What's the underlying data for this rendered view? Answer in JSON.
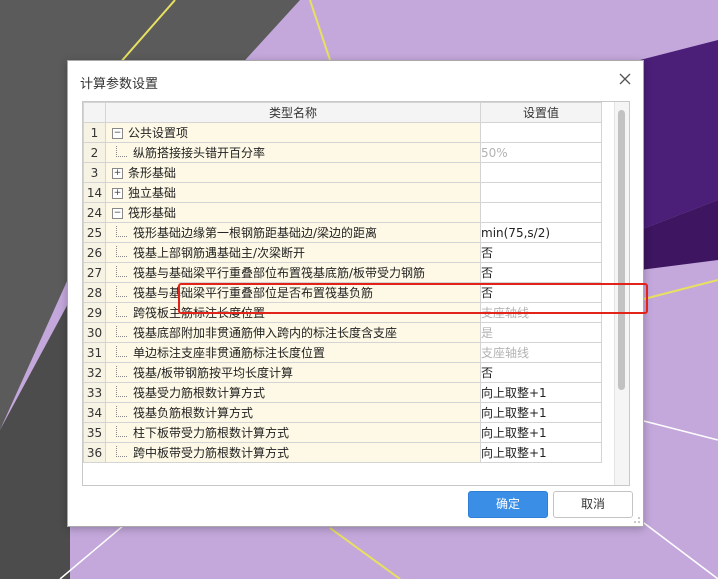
{
  "dialog": {
    "title": "计算参数设置",
    "ok_label": "确定",
    "cancel_label": "取消"
  },
  "table": {
    "headers": [
      "类型名称",
      "设置值"
    ],
    "rows": [
      {
        "num": "1",
        "name": "公共设置项",
        "value": "",
        "kind": "group",
        "expander": "−"
      },
      {
        "num": "2",
        "name": "纵筋搭接接头错开百分率",
        "value": "50%",
        "kind": "child",
        "dim": true
      },
      {
        "num": "3",
        "name": "条形基础",
        "value": "",
        "kind": "group",
        "expander": "+"
      },
      {
        "num": "14",
        "name": "独立基础",
        "value": "",
        "kind": "group",
        "expander": "+"
      },
      {
        "num": "24",
        "name": "筏形基础",
        "value": "",
        "kind": "group",
        "expander": "−"
      },
      {
        "num": "25",
        "name": "筏形基础边缘第一根钢筋距基础边/梁边的距离",
        "value": "min(75,s/2)",
        "kind": "child"
      },
      {
        "num": "26",
        "name": "筏基上部钢筋遇基础主/次梁断开",
        "value": "否",
        "kind": "child"
      },
      {
        "num": "27",
        "name": "筏基与基础梁平行重叠部位布置筏基底筋/板带受力钢筋",
        "value": "否",
        "kind": "child"
      },
      {
        "num": "28",
        "name": "筏基与基础梁平行重叠部位是否布置筏基负筋",
        "value": "否",
        "kind": "child"
      },
      {
        "num": "29",
        "name": "跨筏板主筋标注长度位置",
        "value": "支座轴线",
        "kind": "child",
        "dim": true
      },
      {
        "num": "30",
        "name": "筏基底部附加非贯通筋伸入跨内的标注长度含支座",
        "value": "是",
        "kind": "child",
        "dim": true
      },
      {
        "num": "31",
        "name": "单边标注支座非贯通筋标注长度位置",
        "value": "支座轴线",
        "kind": "child",
        "dim": true
      },
      {
        "num": "32",
        "name": "筏基/板带钢筋按平均长度计算",
        "value": "否",
        "kind": "child"
      },
      {
        "num": "33",
        "name": "筏基受力筋根数计算方式",
        "value": "向上取整+1",
        "kind": "child"
      },
      {
        "num": "34",
        "name": "筏基负筋根数计算方式",
        "value": "向上取整+1",
        "kind": "child"
      },
      {
        "num": "35",
        "name": "柱下板带受力筋根数计算方式",
        "value": "向上取整+1",
        "kind": "child"
      },
      {
        "num": "36",
        "name": "跨中板带受力筋根数计算方式",
        "value": "向上取整+1",
        "kind": "child"
      }
    ]
  },
  "colors": {
    "background": "#c4a8dc",
    "highlight": "#e2231a",
    "primary_button": "#3a8ee6"
  }
}
